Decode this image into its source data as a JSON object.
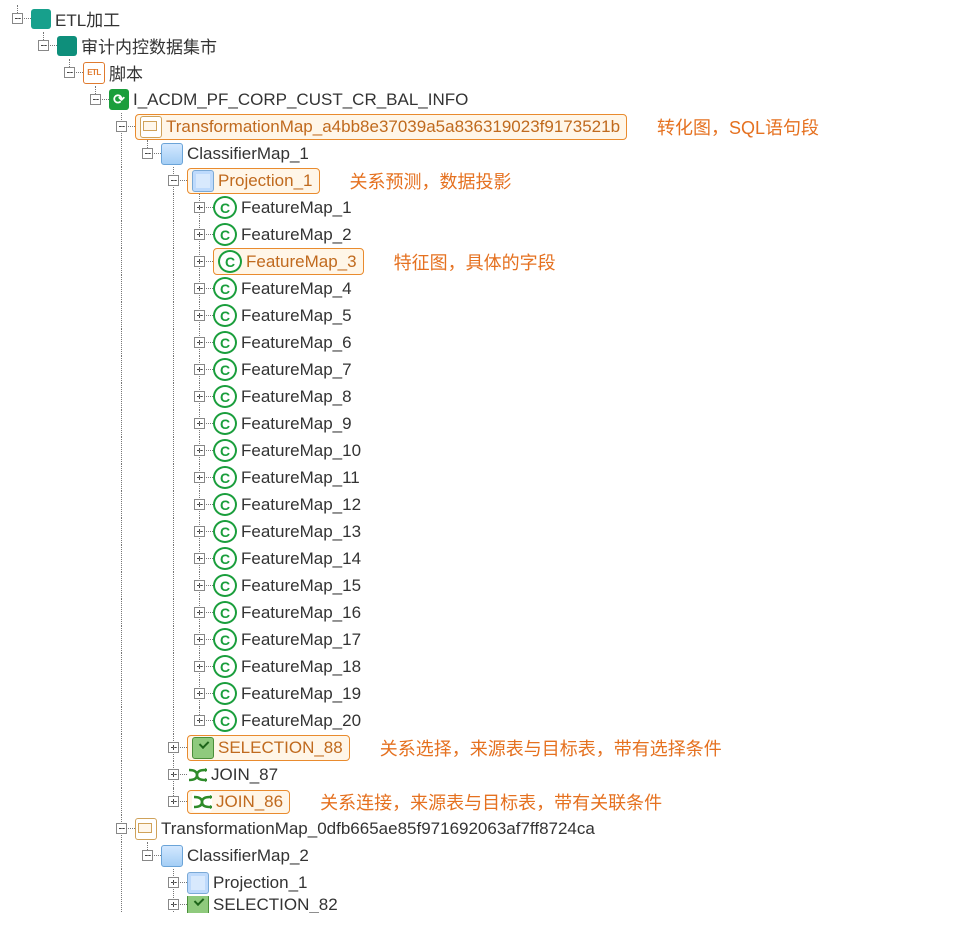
{
  "tree": {
    "n0": {
      "label": "ETL加工",
      "icon": "folder-teal",
      "toggle": "minus"
    },
    "n1": {
      "label": "审计内控数据集市",
      "icon": "folder-teal2",
      "toggle": "minus"
    },
    "n2": {
      "label": "脚本",
      "icon": "etl",
      "toggle": "minus"
    },
    "n3": {
      "label": "I_ACDM_PF_CORP_CUST_CR_BAL_INFO",
      "icon": "refresh",
      "toggle": "minus"
    },
    "n4": {
      "label": "TransformationMap_a4bb8e37039a5a836319023f9173521b",
      "icon": "tmap",
      "toggle": "minus",
      "highlight": true,
      "anno_key": "anno_tmap"
    },
    "n5": {
      "label": "ClassifierMap_1",
      "icon": "cmap",
      "toggle": "minus"
    },
    "n6": {
      "label": "Projection_1",
      "icon": "proj",
      "toggle": "minus",
      "highlight": true,
      "anno_key": "anno_proj"
    },
    "fm": [
      {
        "label": "FeatureMap_1",
        "highlight": false
      },
      {
        "label": "FeatureMap_2",
        "highlight": false
      },
      {
        "label": "FeatureMap_3",
        "highlight": true,
        "anno_key": "anno_feat"
      },
      {
        "label": "FeatureMap_4",
        "highlight": false
      },
      {
        "label": "FeatureMap_5",
        "highlight": false
      },
      {
        "label": "FeatureMap_6",
        "highlight": false
      },
      {
        "label": "FeatureMap_7",
        "highlight": false
      },
      {
        "label": "FeatureMap_8",
        "highlight": false
      },
      {
        "label": "FeatureMap_9",
        "highlight": false
      },
      {
        "label": "FeatureMap_10",
        "highlight": false
      },
      {
        "label": "FeatureMap_11",
        "highlight": false
      },
      {
        "label": "FeatureMap_12",
        "highlight": false
      },
      {
        "label": "FeatureMap_13",
        "highlight": false
      },
      {
        "label": "FeatureMap_14",
        "highlight": false
      },
      {
        "label": "FeatureMap_15",
        "highlight": false
      },
      {
        "label": "FeatureMap_16",
        "highlight": false
      },
      {
        "label": "FeatureMap_17",
        "highlight": false
      },
      {
        "label": "FeatureMap_18",
        "highlight": false
      },
      {
        "label": "FeatureMap_19",
        "highlight": false
      },
      {
        "label": "FeatureMap_20",
        "highlight": false
      }
    ],
    "n_sel": {
      "label": "SELECTION_88",
      "icon": "sel",
      "toggle": "plus",
      "highlight": true,
      "anno_key": "anno_sel"
    },
    "n_join1": {
      "label": "JOIN_87",
      "icon": "join",
      "toggle": "plus"
    },
    "n_join2": {
      "label": "JOIN_86",
      "icon": "join",
      "toggle": "plus",
      "highlight": true,
      "anno_key": "anno_join"
    },
    "n_tmap2": {
      "label": "TransformationMap_0dfb665ae85f971692063af7ff8724ca",
      "icon": "tmap",
      "toggle": "minus"
    },
    "n_cmap2": {
      "label": "ClassifierMap_2",
      "icon": "cmap",
      "toggle": "minus"
    },
    "n_proj2": {
      "label": "Projection_1",
      "icon": "proj",
      "toggle": "plus"
    },
    "n_sel2": {
      "label": "SELECTION_82",
      "icon": "sel",
      "toggle": "plus"
    }
  },
  "icon_text": {
    "etl": "ETL",
    "refresh": "⟳"
  },
  "annotations": {
    "anno_tmap": "转化图，SQL语句段",
    "anno_proj": "关系预测，数据投影",
    "anno_feat": "特征图，具体的字段",
    "anno_sel": "关系选择，来源表与目标表，带有选择条件",
    "anno_join": "关系连接，来源表与目标表，带有关联条件"
  }
}
